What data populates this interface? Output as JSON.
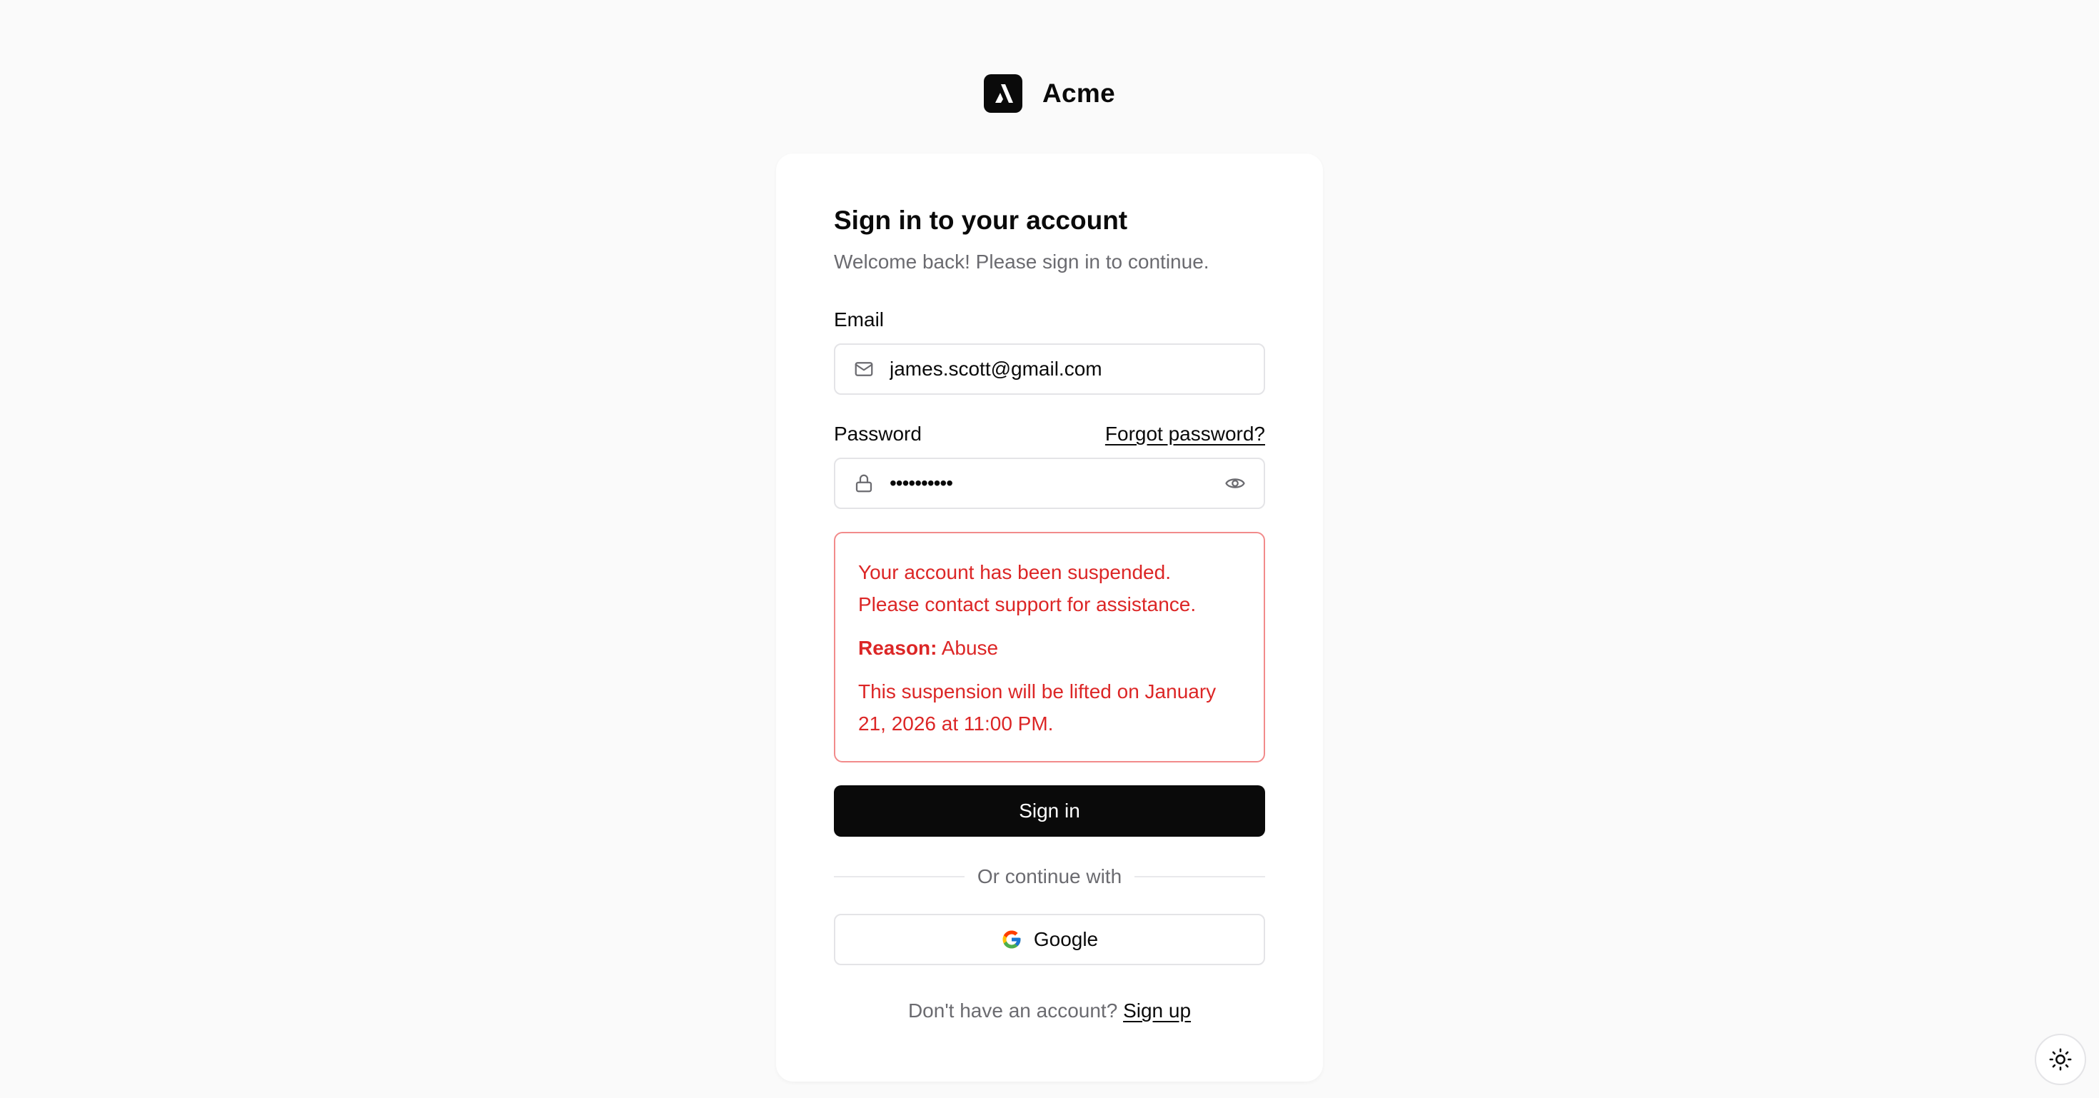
{
  "brand": {
    "name": "Acme",
    "logo_icon": "acme-logo-icon"
  },
  "signin": {
    "title": "Sign in to your account",
    "subtitle": "Welcome back! Please sign in to continue.",
    "email": {
      "label": "Email",
      "value": "james.scott@gmail.com",
      "icon": "mail-icon"
    },
    "password": {
      "label": "Password",
      "forgot_label": "Forgot password?",
      "value": "••••••••••",
      "icon": "lock-icon",
      "toggle_icon": "eye-icon"
    },
    "error": {
      "line1": "Your account has been suspended.",
      "line2": "Please contact support for assistance.",
      "reason_label": "Reason:",
      "reason_value": "Abuse",
      "lifted": "This suspension will be lifted on January 21, 2026 at 11:00 PM."
    },
    "submit_label": "Sign in",
    "divider_text": "Or continue with",
    "google_label": "Google",
    "footer_text": "Don't have an account?",
    "signup_label": "Sign up"
  },
  "theme_toggle": {
    "icon": "sun-icon"
  },
  "colors": {
    "background": "#fafafa",
    "card": "#ffffff",
    "primary": "#0a0a0a",
    "error": "#dc2626",
    "error_border": "#f28b8b",
    "muted_text": "#6b6b70"
  }
}
